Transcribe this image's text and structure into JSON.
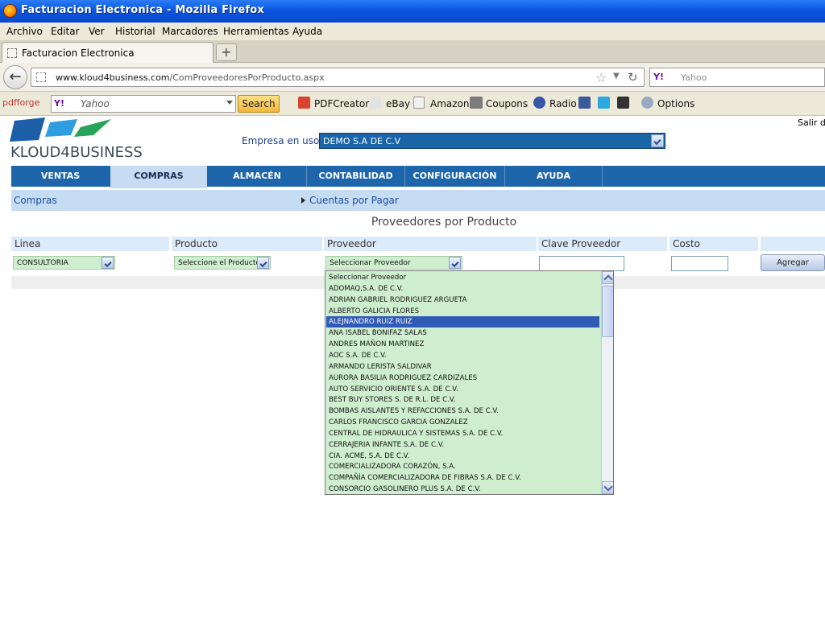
{
  "window": {
    "title": "Facturacion Electronica - Mozilla Firefox"
  },
  "menu": [
    "Archivo",
    "Editar",
    "Ver",
    "Historial",
    "Marcadores",
    "Herramientas",
    "Ayuda"
  ],
  "tab": {
    "title": "Facturacion Electronica",
    "new_tab": "+"
  },
  "address": {
    "domain": "www.kloud4business.com",
    "path": "/ComProveedoresPorProducto.aspx"
  },
  "web_search": {
    "placeholder": "Yahoo",
    "logo": "Y!"
  },
  "toolbar": {
    "pdfforge": "pdfforge",
    "yahoo_logo": "Y!",
    "search_value": "Yahoo",
    "search_button": "Search",
    "items": [
      "PDFCreator",
      "eBay",
      "Amazon",
      "Coupons",
      "Radio",
      "Options"
    ]
  },
  "header": {
    "logo_text": "KLOUD4BUSINESS",
    "salir": "Salir d",
    "empresa_label": "Empresa en uso:",
    "empresa_value": "DEMO S.A DE C.V"
  },
  "main_nav": [
    "VENTAS",
    "COMPRAS",
    "ALMACÉN",
    "CONTABILIDAD",
    "CONFIGURACIÓN",
    "AYUDA"
  ],
  "sub_nav": {
    "section": "Compras",
    "link": "Cuentas por Pagar"
  },
  "form": {
    "title": "Proveedores por Producto",
    "headers": [
      "Linea",
      "Producto",
      "Proveedor",
      "Clave Proveedor",
      "Costo"
    ],
    "linea_value": "CONSULTORIA",
    "producto_value": "Seleccione el Producto",
    "proveedor_value": "Seleccionar Proveedor",
    "clave_value": "",
    "costo_value": "",
    "add_button": "Agregar"
  },
  "proveedor_options": [
    "Seleccionar Proveedor",
    "ADOMAQ,S.A. DE C.V.",
    "ADRIAN GABRIEL RODRIGUEZ ARGUETA",
    "ALBERTO GALICIA FLORES",
    "ALEJNANDRO RUIZ RUIZ",
    "ANA ISABEL BONIFAZ SALAS",
    "ANDRES MAÑON MARTINEZ",
    "AOC S.A. DE C.V.",
    "ARMANDO LERISTA SALDIVAR",
    "AURORA BASILIA RODRIGUEZ CARDIZALES",
    "AUTO SERVICIO ORIENTE S.A. DE C.V.",
    "BEST BUY STORES S. DE R.L. DE C.V.",
    "BOMBAS AISLANTES Y REFACCIONES S.A. DE C.V.",
    "CARLOS FRANCISCO GARCIA GONZALEZ",
    "CENTRAL DE HIDRAULICA Y SISTEMAS S.A. DE C.V.",
    "CERRAJERIA INFANTE S.A. DE C.V.",
    "CIA. ACME, S.A. DE C.V.",
    "COMERCIALIZADORA CORAZÓN, S.A.",
    "COMPAÑÍA COMERCIALIZADORA DE FIBRAS S.A. DE C.V.",
    "CONSORCIO GASOLINERO PLUS S.A. DE C.V."
  ],
  "highlighted_option": "ALEJNANDRO RUIZ RUIZ",
  "colors": {
    "nav_blue": "#1d66ab",
    "active_tab": "#c7dbf3",
    "select_green": "#cfeecf",
    "highlight": "#2f5ab6"
  }
}
